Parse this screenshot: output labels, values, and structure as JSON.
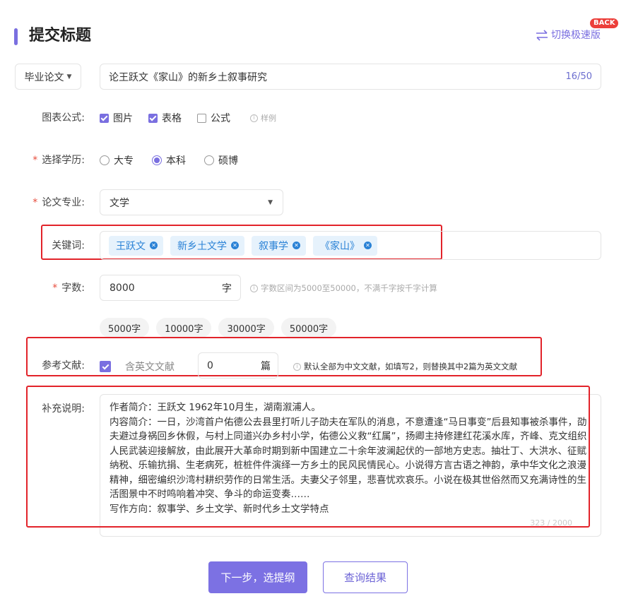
{
  "header": {
    "title": "提交标题",
    "switch_link": "切换极速版",
    "back_badge": "BACK"
  },
  "title_row": {
    "type_select": "毕业论文",
    "title_value": "论王跃文《家山》的新乡土叙事研究",
    "char_count": "16/50"
  },
  "chart_formula": {
    "label": "图表公式:",
    "options": [
      {
        "label": "图片",
        "checked": true
      },
      {
        "label": "表格",
        "checked": true
      },
      {
        "label": "公式",
        "checked": false
      }
    ],
    "hint": "样例"
  },
  "education": {
    "required_mark": "*",
    "label": "选择学历:",
    "options": [
      {
        "label": "大专",
        "selected": false
      },
      {
        "label": "本科",
        "selected": true
      },
      {
        "label": "硕博",
        "selected": false
      }
    ]
  },
  "major": {
    "required_mark": "*",
    "label": "论文专业:",
    "value": "文学"
  },
  "keywords": {
    "label": "关键词:",
    "tags": [
      "王跃文",
      "新乡土文学",
      "叙事学",
      "《家山》"
    ]
  },
  "word_count": {
    "required_mark": "*",
    "label": "字数:",
    "value": "8000",
    "unit": "字",
    "hint": "字数区间为5000至50000，不满千字按千字计算",
    "presets": [
      "5000字",
      "10000字",
      "30000字",
      "50000字"
    ]
  },
  "references": {
    "label": "参考文献:",
    "include_english_label": "含英文文献",
    "include_english_checked": true,
    "count_value": "0",
    "count_unit": "篇",
    "hint": "默认全部为中文文献，如填写2，则替换其中2篇为英文文献"
  },
  "notes": {
    "label": "补充说明:",
    "lines": [
      "作者简介：王跃文 1962年10月生，湖南溆浦人。",
      "内容简介：一日，沙湾首户佑德公去县里打听儿子劭夫在军队的消息，不意遭逢“马日事变”后县知事被杀事件，劭夫避过身祸回乡休假，与村上同道兴办乡村小学，佑德公义救“红属”，扬卿主持修建红花溪水库，齐峰、克文组织人民武装迎接解放，由此展开大革命时期到新中国建立二十余年波澜起伏的一部地方史志。抽壮丁、大洪水、征赋纳税、乐输抗捐、生老病死，桩桩件件演绎一方乡土的民风民情民心。小说得方言古语之神韵，承中华文化之浪漫精神，细密编织沙湾村耕织劳作的日常生活。夫妻父子邻里，悲喜忧欢哀乐。小说在极其世俗然而又充满诗性的生活图景中不时鸣响着冲突、争斗的命运变奏……",
      "写作方向：叙事学、乡土文学、新时代乡土文学特点"
    ],
    "count": "323 / 2000"
  },
  "actions": {
    "next_label": "下一步，选提纲",
    "query_label": "查询结果"
  },
  "colors": {
    "accent": "#7a6fe0",
    "tag_bg": "#e6f2fc",
    "tag_text": "#2a82d6",
    "highlight": "#e2232a",
    "required": "#e74c3c"
  }
}
